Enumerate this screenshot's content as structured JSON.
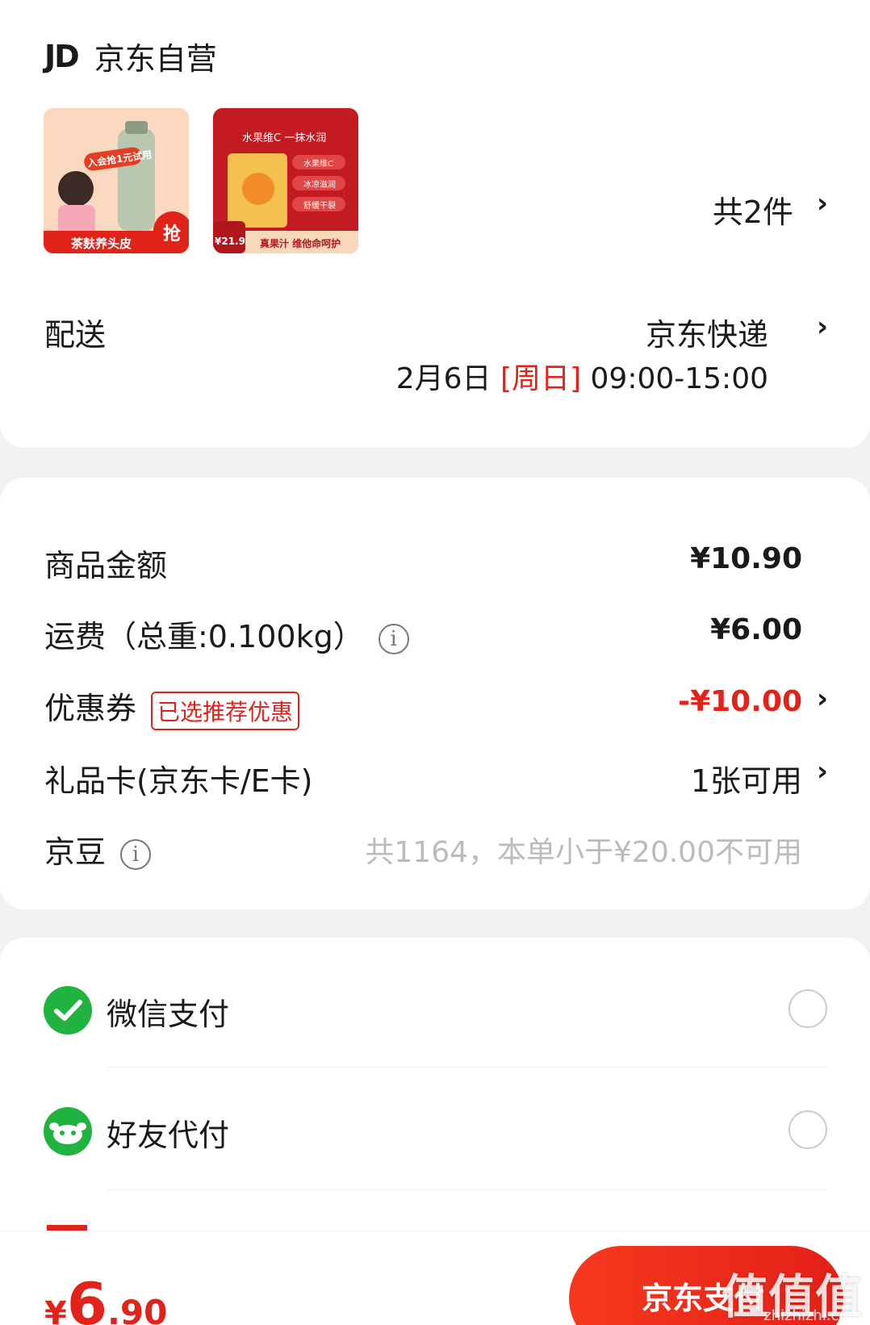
{
  "shop": {
    "logo": "JD",
    "name": "京东自营"
  },
  "products": {
    "item1": {
      "badge": "入会抢1元试用",
      "caption": "茶麸养头皮",
      "flag": "抢"
    },
    "item2": {
      "headline": "水果维C 一抹水润",
      "tags": [
        "水果维C",
        "冰凉滋润",
        "舒缓干裂"
      ],
      "price": "¥21.9",
      "caption": "真果汁 维他命呵护"
    },
    "count_label": "共2件"
  },
  "delivery": {
    "label": "配送",
    "carrier": "京东快递",
    "date": "2月6日",
    "weekday": "[周日]",
    "time": "09:00-15:00"
  },
  "summary": {
    "goods": {
      "label": "商品金额",
      "value": "¥10.90"
    },
    "shipping": {
      "label": "运费（总重:0.100kg）",
      "value": "¥6.00"
    },
    "coupon": {
      "label": "优惠券",
      "tag": "已选推荐优惠",
      "value": "-¥10.00"
    },
    "giftcard": {
      "label": "礼品卡(京东卡/E卡)",
      "value": "1张可用"
    },
    "jingdou": {
      "label": "京豆",
      "value": "共1164，本单小于¥20.00不可用"
    }
  },
  "payment": {
    "wechat": {
      "label": "微信支付"
    },
    "friend": {
      "label": "好友代付"
    }
  },
  "footer": {
    "currency": "¥",
    "amount_int": "6",
    "amount_dec": ".90",
    "pay_button": "京东支付",
    "watermark": "值值值",
    "watermark_url": "zhizhizhi.com"
  },
  "colors": {
    "accent": "#e2231a",
    "wechat_green": "#21b33f"
  }
}
